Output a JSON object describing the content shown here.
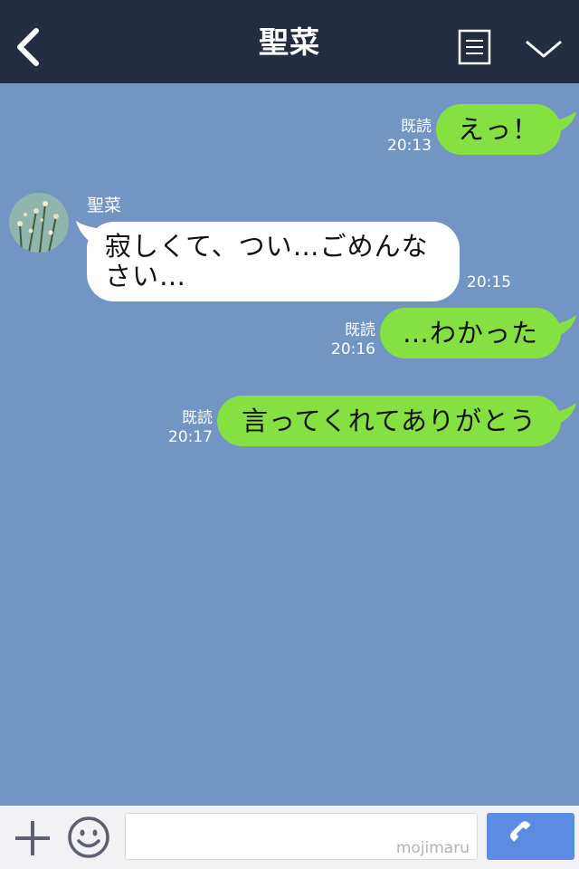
{
  "header": {
    "title": "聖菜"
  },
  "chat": {
    "sender_name": "聖菜",
    "messages": [
      {
        "from": "me",
        "text": "えっ！",
        "read_label": "既読",
        "time": "20:13"
      },
      {
        "from": "them",
        "text": "寂しくて、つい…ごめんなさい…",
        "time": "20:15"
      },
      {
        "from": "me",
        "text": "…わかった",
        "read_label": "既読",
        "time": "20:16"
      },
      {
        "from": "me",
        "text": "言ってくれてありがとう",
        "read_label": "既読",
        "time": "20:17"
      }
    ]
  },
  "input": {
    "watermark": "mojimaru"
  },
  "colors": {
    "header_bg": "#232c41",
    "chat_bg": "#7395c3",
    "my_bubble": "#84e141",
    "their_bubble": "#ffffff",
    "call_button": "#5b8be3"
  },
  "icons": [
    "back-arrow-icon",
    "notes-icon",
    "chevron-down-icon",
    "plus-icon",
    "emoji-icon",
    "phone-icon"
  ]
}
